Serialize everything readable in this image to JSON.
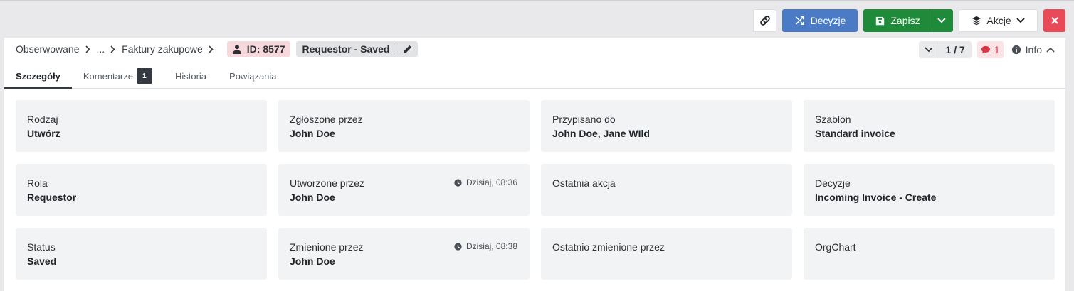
{
  "toolbar": {
    "link_icon": "link-icon",
    "decisions_label": "Decyzje",
    "save_label": "Zapisz",
    "actions_label": "Akcje"
  },
  "breadcrumb": {
    "items": [
      "Obserwowane",
      "...",
      "Faktury zakupowe"
    ],
    "id_label": "ID: 8577",
    "state_label": "Requestor - Saved"
  },
  "nav": {
    "position": "1 / 7",
    "comments_count": "1",
    "info_label": "Info"
  },
  "tabs": [
    {
      "label": "Szczegóły",
      "active": true
    },
    {
      "label": "Komentarze",
      "count": "1"
    },
    {
      "label": "Historia"
    },
    {
      "label": "Powiązania"
    }
  ],
  "fields": [
    {
      "label": "Rodzaj",
      "value": "Utwórz"
    },
    {
      "label": "Zgłoszone przez",
      "value": "John Doe"
    },
    {
      "label": "Przypisano do",
      "value": "John Doe, Jane WIld"
    },
    {
      "label": "Szablon",
      "value": "Standard invoice"
    },
    {
      "label": "Rola",
      "value": "Requestor"
    },
    {
      "label": "Utworzone przez",
      "value": "John Doe",
      "time": "Dzisiaj, 08:36"
    },
    {
      "label": "Ostatnia akcja",
      "value": ""
    },
    {
      "label": "Decyzje",
      "value": "Incoming Invoice - Create"
    },
    {
      "label": "Status",
      "value": "Saved"
    },
    {
      "label": "Zmienione przez",
      "value": "John Doe",
      "time": "Dzisiaj, 08:38"
    },
    {
      "label": "Ostatnio zmienione przez",
      "value": ""
    },
    {
      "label": "OrgChart",
      "value": ""
    }
  ],
  "colors": {
    "primary": "#4a7bc4",
    "success": "#1e8a3a",
    "danger": "#e84a57",
    "id_badge": "#f7d8dc",
    "card_bg": "#f2f3f4"
  }
}
